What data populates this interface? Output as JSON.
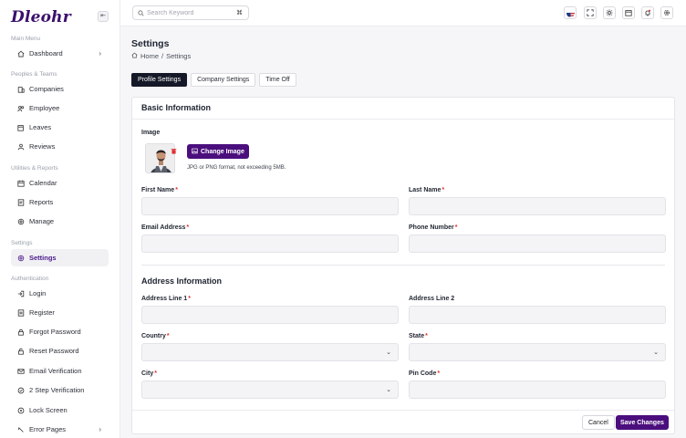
{
  "brand": "Dleohr",
  "sidebar": {
    "sections": {
      "main_menu": "Main Menu",
      "peoples_teams": "Peoples & Teams",
      "utilities_reports": "Utilities & Reports",
      "settings": "Settings",
      "authentication": "Authentication"
    },
    "items": {
      "dashboard": "Dashboard",
      "companies": "Companies",
      "employee": "Employee",
      "leaves": "Leaves",
      "reviews": "Reviews",
      "calendar": "Calendar",
      "reports": "Reports",
      "manage": "Manage",
      "settings": "Settings",
      "login": "Login",
      "register": "Register",
      "forgot_password": "Forgot Password",
      "reset_password": "Reset Password",
      "email_verification": "Email Verification",
      "two_step": "2 Step Verification",
      "lock_screen": "Lock Screen",
      "error_pages": "Error Pages"
    }
  },
  "topbar": {
    "search_placeholder": "Search Keyword",
    "shortcut": "⌘"
  },
  "page": {
    "title": "Settings",
    "breadcrumb_home": "Home",
    "breadcrumb_sep": "/",
    "breadcrumb_current": "Settings"
  },
  "tabs": [
    "Profile Settings",
    "Company Settings",
    "Time Off"
  ],
  "basic": {
    "title": "Basic Information",
    "image_label": "Image",
    "change_image": "Change Image",
    "image_note": "JPG or PNG format, not exceeding 5MB.",
    "first_name": "First Name",
    "last_name": "Last Name",
    "email": "Email Address",
    "phone": "Phone Number"
  },
  "address": {
    "title": "Address Information",
    "line1": "Address Line 1",
    "line2": "Address Line 2",
    "country": "Country",
    "state": "State",
    "city": "City",
    "pin": "Pin Code"
  },
  "required_mark": "*",
  "actions": {
    "cancel": "Cancel",
    "save": "Save Changes"
  },
  "colors": {
    "accent": "#4b0f7d",
    "required": "#e03131",
    "dark_tab": "#151826"
  }
}
